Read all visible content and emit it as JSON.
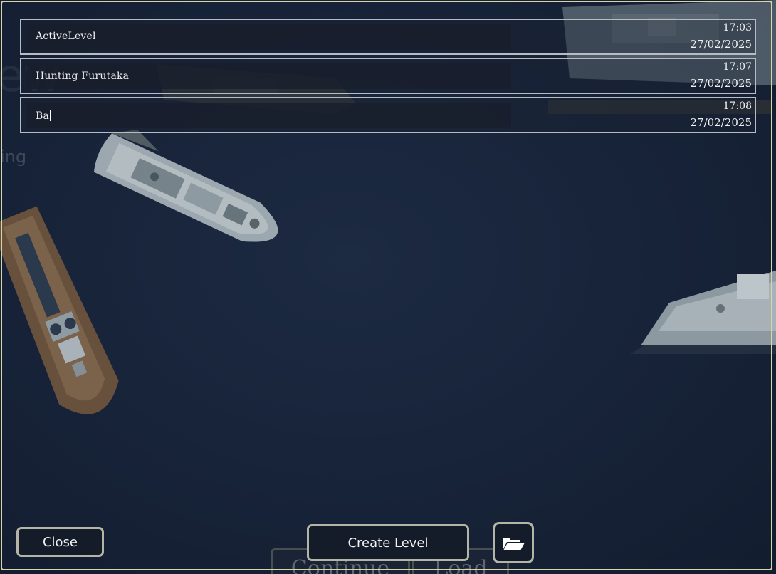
{
  "levels": [
    {
      "name": "ActiveLevel",
      "time": "17:03",
      "date": "27/02/2025"
    },
    {
      "name": "Hunting Furutaka",
      "time": "17:07",
      "date": "27/02/2025"
    },
    {
      "name": "Ba",
      "time": "17:08",
      "date": "27/02/2025",
      "editing": true
    }
  ],
  "buttons": {
    "close_label": "Close",
    "create_label": "Create Level"
  },
  "background": {
    "continue_label": "Continue",
    "load_label": "Load",
    "ghost_fragment": "ing"
  },
  "icons": {
    "folder": "folder-open-icon"
  },
  "colors": {
    "panel_border": "#d8d6a8",
    "row_border": "#b8bcc2",
    "button_border": "#b3b5a6",
    "background": "#17233a"
  }
}
